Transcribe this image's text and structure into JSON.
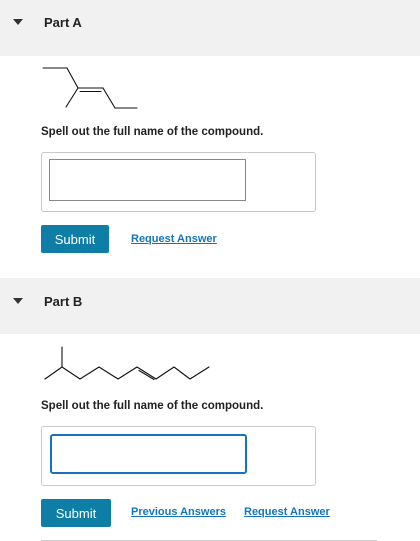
{
  "part_a": {
    "title": "Part A",
    "prompt": "Spell out the full name of the compound.",
    "answer_value": "",
    "submit_label": "Submit",
    "request_answer_label": "Request Answer"
  },
  "part_b": {
    "title": "Part B",
    "prompt": "Spell out the full name of the compound.",
    "answer_value": "",
    "submit_label": "Submit",
    "previous_answers_label": "Previous Answers",
    "request_answer_label": "Request Answer"
  },
  "colors": {
    "header_bg": "#f1f1f1",
    "button_bg": "#0f7ea7",
    "link": "#1476b8",
    "focus_border": "#1a6fc2"
  }
}
